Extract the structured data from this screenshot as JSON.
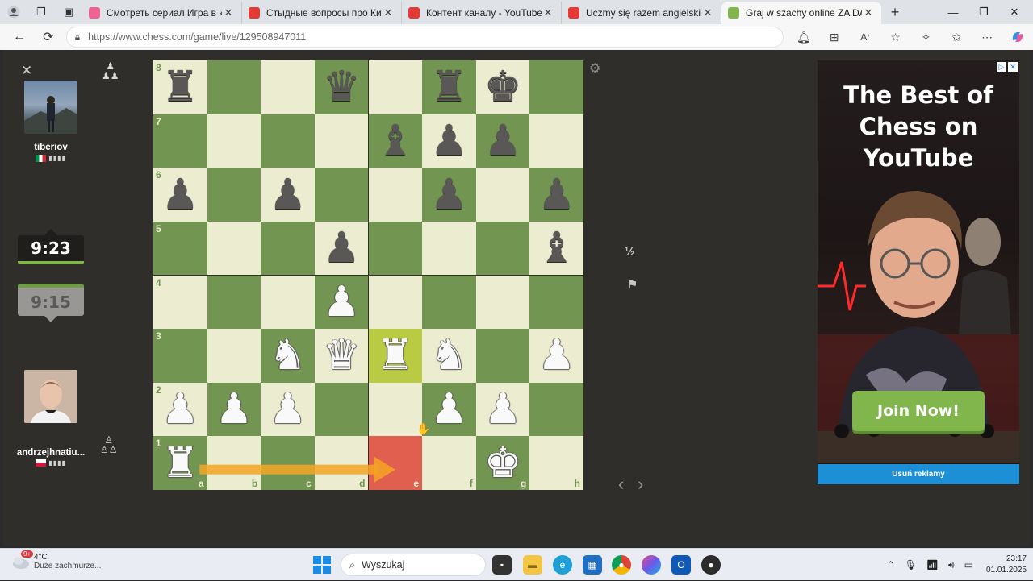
{
  "browser": {
    "tabs": [
      {
        "title": "Смотреть сериал Игра в кальмара",
        "favicon_color": "#f06292",
        "active": false
      },
      {
        "title": "Стыдные вопросы про Китай / е",
        "favicon_color": "#e53935",
        "active": false
      },
      {
        "title": "Контент каналу - YouTube Studio",
        "favicon_color": "#e53935",
        "active": false
      },
      {
        "title": "Uczmy się razem angielskiego cz",
        "favicon_color": "#e53935",
        "active": false
      },
      {
        "title": "Graj w szachy online ZA DARMO",
        "favicon_color": "#81b64c",
        "active": true
      }
    ],
    "new_tab": "+",
    "url": "https://www.chess.com/game/live/129508947011"
  },
  "game": {
    "top_player": {
      "name": "tiberiov",
      "flag": "Italy",
      "clock": "9:23"
    },
    "bottom_player": {
      "name": "andrzejhnatiu...",
      "flag": "Poland",
      "clock": "9:15"
    },
    "draw_label": "½",
    "files": [
      "a",
      "b",
      "c",
      "d",
      "e",
      "f",
      "g",
      "h"
    ],
    "ranks": [
      "8",
      "7",
      "6",
      "5",
      "4",
      "3",
      "2",
      "1"
    ],
    "position": {
      "a8": "bR",
      "d8": "bQ",
      "f8": "bR",
      "g8": "bK",
      "e7": "bB",
      "f7": "bP",
      "g7": "bP",
      "a6": "bP",
      "c6": "bP",
      "f6": "bP",
      "h6": "bP",
      "d5": "bP",
      "h5": "bB",
      "d4": "wP",
      "c3": "wN",
      "d3": "wQ",
      "e3": "wR",
      "f3": "wN",
      "h3": "wP",
      "a2": "wP",
      "b2": "wP",
      "c2": "wP",
      "f2": "wP",
      "g2": "wP",
      "a1": "wR",
      "g1": "wK"
    },
    "highlight_squares": [
      "e3"
    ],
    "marked_squares": [
      "e1"
    ],
    "arrow": {
      "from": "a1",
      "to": "e1",
      "color": "#f5a623"
    }
  },
  "ad": {
    "headline": "The Best of Chess on YouTube",
    "cta": "Join Now!",
    "remove_label": "Usuń reklamy"
  },
  "taskbar": {
    "weather_temp": "4°C",
    "weather_desc": "Duże zachmurze...",
    "weather_badge": "9+",
    "search_placeholder": "Wyszukaj",
    "time": "23:17",
    "date": "01.01.2025"
  }
}
